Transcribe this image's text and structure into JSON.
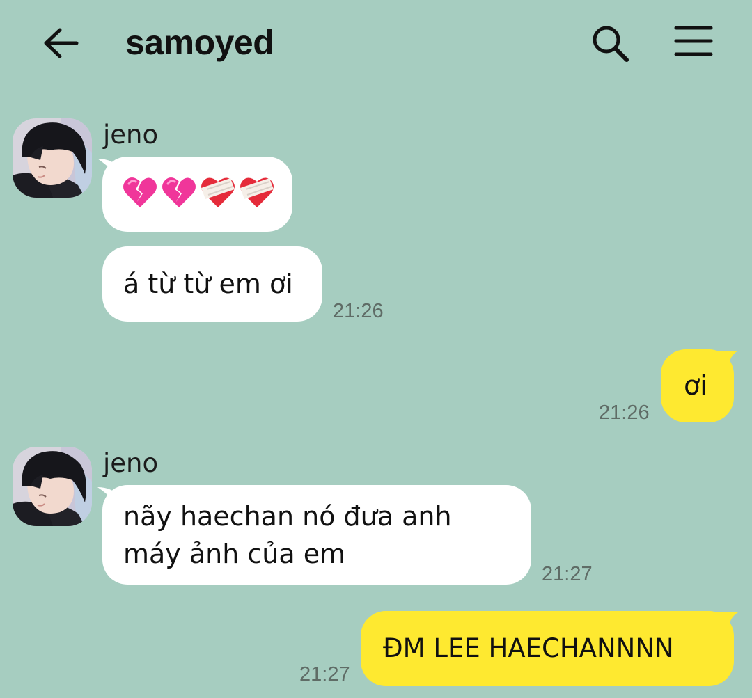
{
  "header": {
    "title": "samoyed",
    "back_icon": "arrow-left-icon",
    "search_icon": "search-icon",
    "menu_icon": "hamburger-menu-icon"
  },
  "colors": {
    "background": "#a6cdc0",
    "incoming_bubble": "#ffffff",
    "outgoing_bubble": "#fee930",
    "timestamp": "#5f6c66"
  },
  "messages": [
    {
      "sender": "jeno",
      "direction": "incoming",
      "bubbles": [
        {
          "type": "emoji",
          "emojis": [
            "broken-heart",
            "broken-heart",
            "mending-heart",
            "mending-heart"
          ]
        },
        {
          "type": "text",
          "text": "á từ từ em ơi"
        }
      ],
      "time": "21:26"
    },
    {
      "direction": "outgoing",
      "bubbles": [
        {
          "type": "text",
          "text": "ơi"
        }
      ],
      "time": "21:26"
    },
    {
      "sender": "jeno",
      "direction": "incoming",
      "bubbles": [
        {
          "type": "text",
          "lines": [
            "nãy haechan nó đưa anh",
            "máy ảnh của em"
          ]
        }
      ],
      "time": "21:27"
    },
    {
      "direction": "outgoing",
      "bubbles": [
        {
          "type": "text",
          "text": "ĐM LEE HAECHANNNN"
        }
      ],
      "time": "21:27"
    }
  ]
}
